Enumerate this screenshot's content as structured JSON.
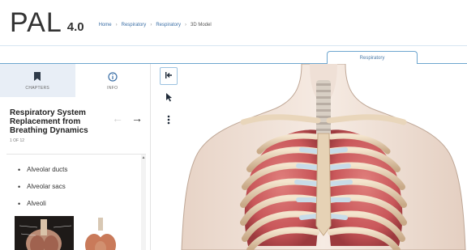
{
  "app": {
    "logo": "PAL",
    "version": "4.0"
  },
  "breadcrumb": [
    "Home",
    "Respiratory",
    "Respiratory",
    "3D Model"
  ],
  "viewer_tab": {
    "label": "Respiratory"
  },
  "panel_tabs": [
    {
      "label": "CHAPTERS",
      "icon": "bookmark-icon"
    },
    {
      "label": "INFO",
      "icon": "info-icon"
    }
  ],
  "chapter": {
    "title": "Respiratory System Replacement from Breathing Dynamics",
    "count": "1 OF 12"
  },
  "nav": {
    "prev": "←",
    "next": "→"
  },
  "bullets": [
    "Alveolar ducts",
    "Alveolar sacs",
    "Alveoli"
  ],
  "toolbar": [
    {
      "icon": "collapse-panel-icon"
    },
    {
      "icon": "pointer-icon"
    },
    {
      "icon": "more-vertical-icon"
    }
  ],
  "colors": {
    "accent_blue": "#6ea6cf",
    "active_tab_bg": "#e8eef6",
    "lung_red": "#c9575a",
    "rib_bone": "#e8d3b6",
    "cartilage": "#c8dbe8",
    "skin": "#f1e2d8"
  }
}
